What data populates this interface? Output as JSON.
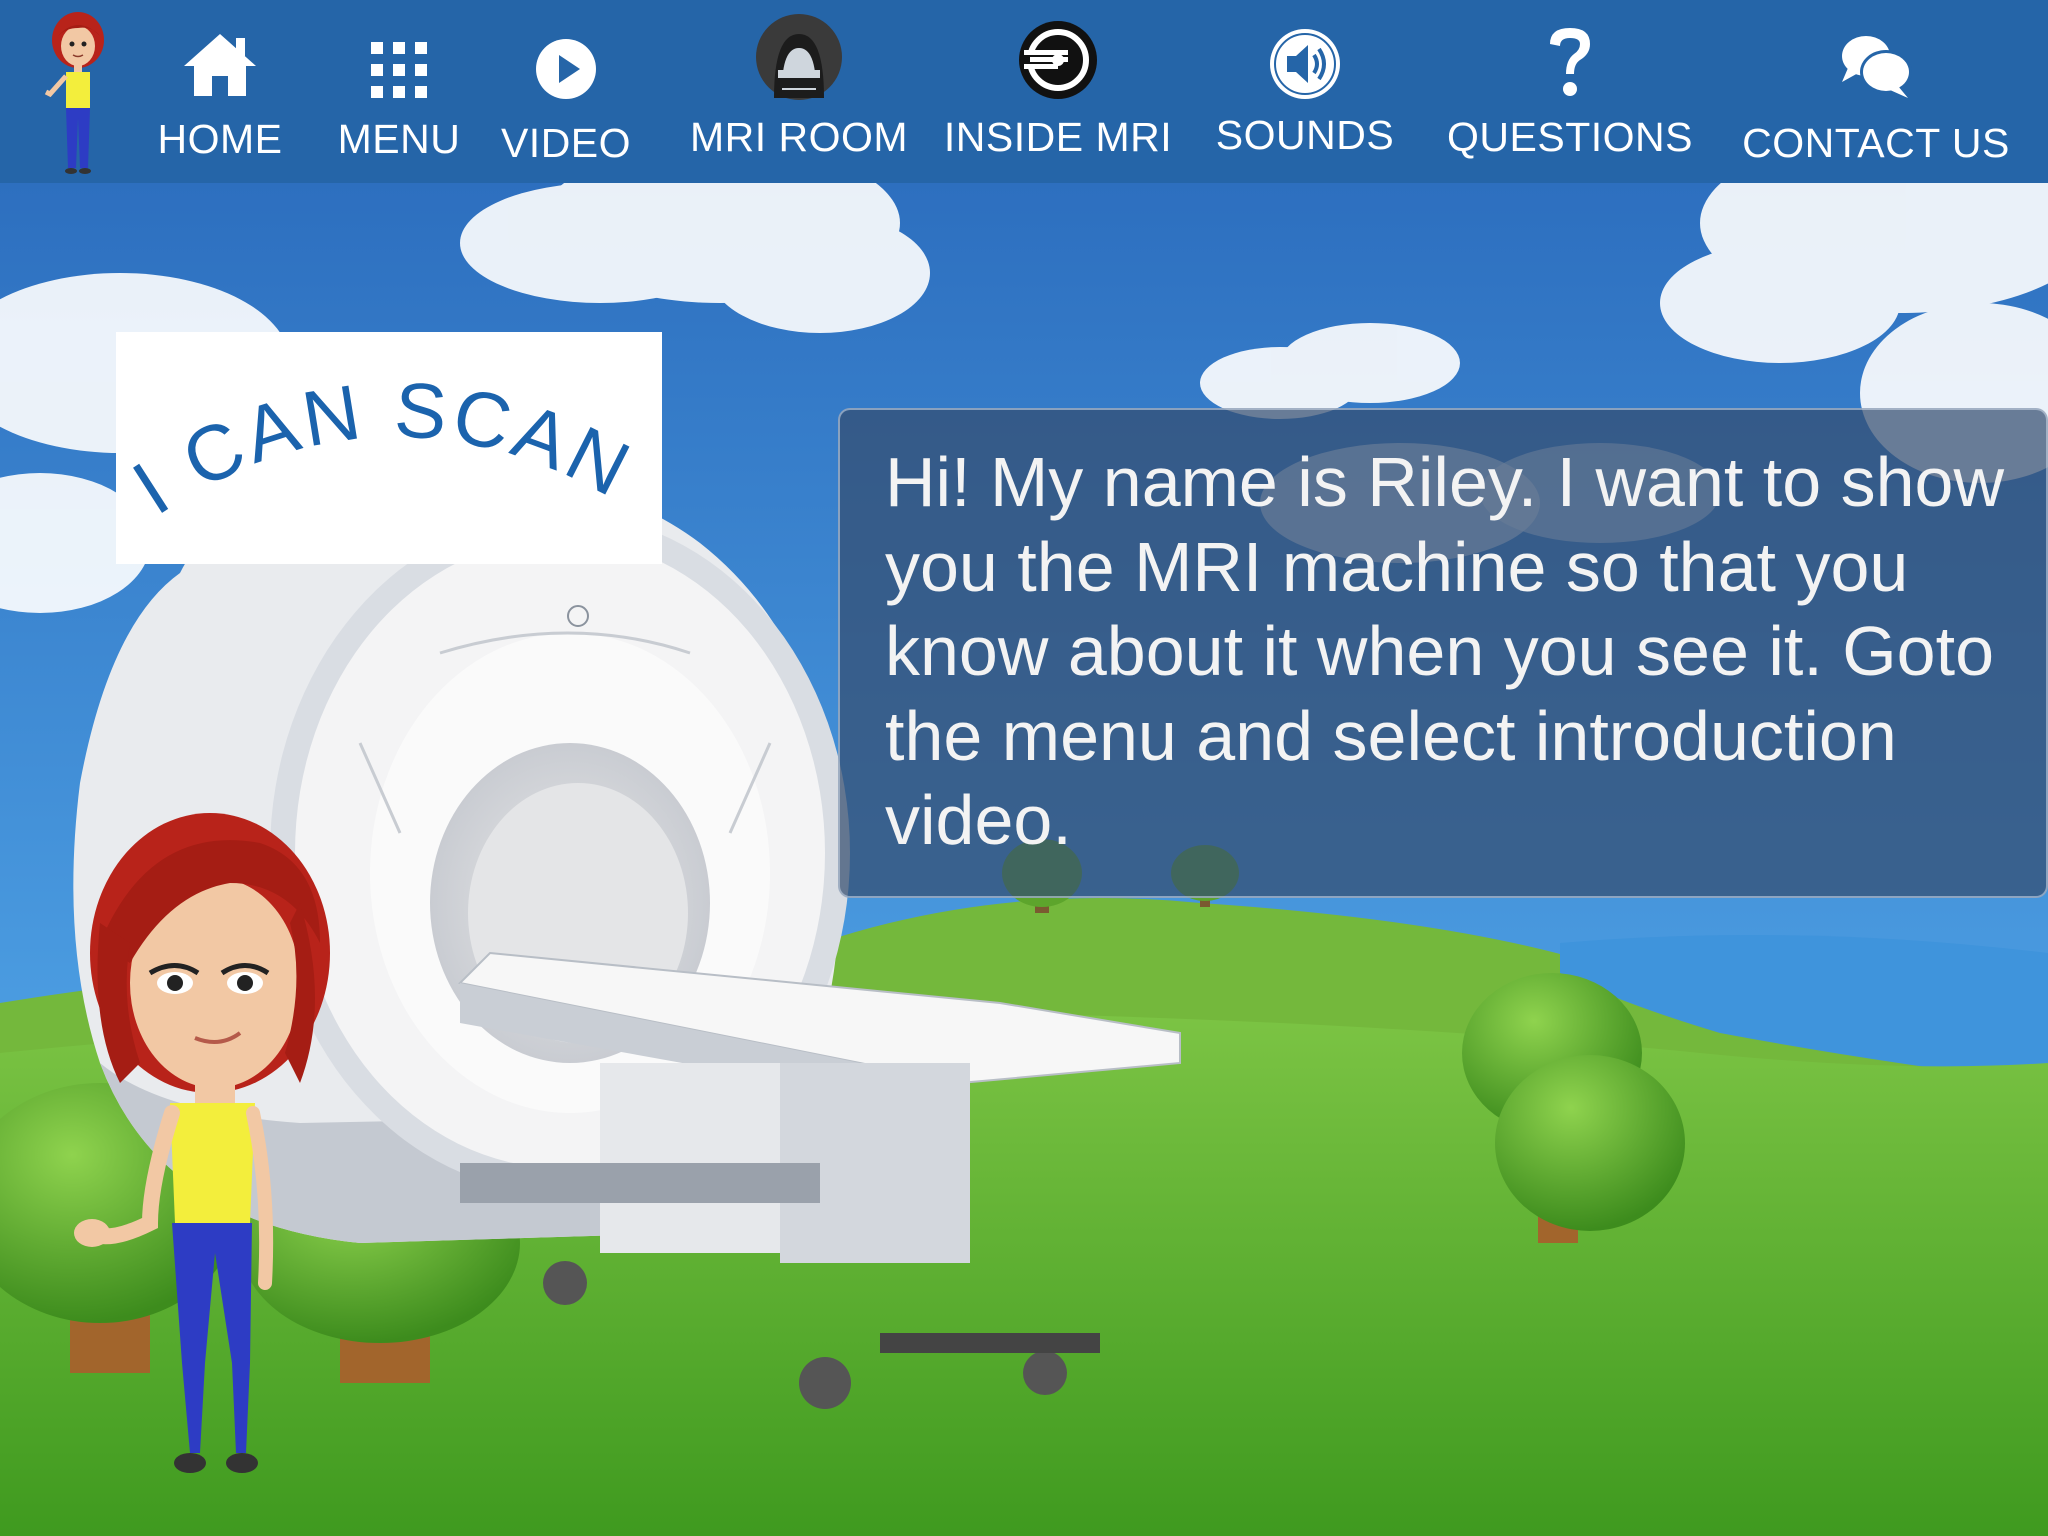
{
  "nav": {
    "avatar_icon": "riley-avatar",
    "items": [
      {
        "label": "HOME",
        "icon": "home-icon"
      },
      {
        "label": "MENU",
        "icon": "grid-menu-icon"
      },
      {
        "label": "VIDEO",
        "icon": "play-icon"
      },
      {
        "label": "MRI ROOM",
        "icon": "mri-room-icon"
      },
      {
        "label": "INSIDE MRI",
        "icon": "inside-mri-icon"
      },
      {
        "label": "SOUNDS",
        "icon": "speaker-icon"
      },
      {
        "label": "QUESTIONS",
        "icon": "question-icon"
      },
      {
        "label": "CONTACT US",
        "icon": "chat-bubbles-icon"
      }
    ]
  },
  "logo": {
    "text": "I CAN SCAN"
  },
  "speech": {
    "text": "Hi! My name is Riley. I want to show you the MRI machine so that you know about it when you see it. Goto the menu and select introduction video."
  },
  "colors": {
    "nav_bg": "#2565a8",
    "logo_text": "#1b63ad",
    "speech_bg": "rgba(52,78,112,0.72)",
    "grass": "#5fae2c",
    "sky": "#3f8fd8"
  }
}
